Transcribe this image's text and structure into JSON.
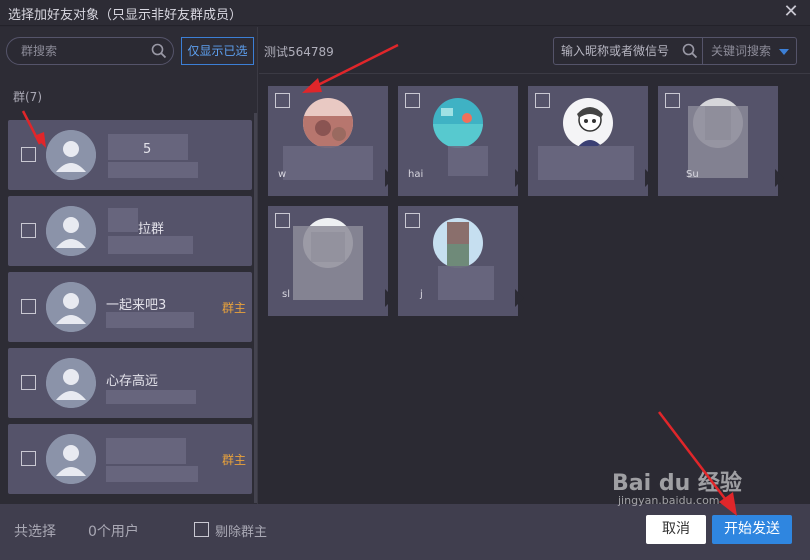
{
  "window": {
    "title": "选择加好友对象（只显示非好友群成员）",
    "close_label": "✕"
  },
  "left": {
    "search_placeholder": "群搜索",
    "show_selected_label": "仅显示已选",
    "group_count_label": "群(7)",
    "groups": [
      {
        "name": "5",
        "owner_badge": ""
      },
      {
        "name": "拉群",
        "owner_badge": ""
      },
      {
        "name": "一起来吧3",
        "owner_badge": "群主"
      },
      {
        "name": "心存高远",
        "owner_badge": ""
      },
      {
        "name": "",
        "owner_badge": "群主"
      }
    ]
  },
  "right": {
    "current_group_name": "测试564789",
    "nick_search_placeholder": "输入昵称或者微信号",
    "keyword_select_label": "关键词搜索",
    "members": [
      {
        "name": "w"
      },
      {
        "name": "hai"
      },
      {
        "name": ""
      },
      {
        "name": "Su"
      },
      {
        "name": "sl"
      },
      {
        "name": "j"
      }
    ]
  },
  "footer": {
    "selected_label": "共选择",
    "selected_count": "0个用户",
    "exclude_owner_label": "剔除群主",
    "cancel_label": "取消",
    "send_label": "开始发送"
  },
  "watermark": {
    "text": "Bai du 经验",
    "subtext": "jingyan.baidu.com"
  },
  "colors": {
    "accent": "#2f86e0",
    "owner_badge": "#e9a23b",
    "annotation_arrow": "#e0262a"
  }
}
